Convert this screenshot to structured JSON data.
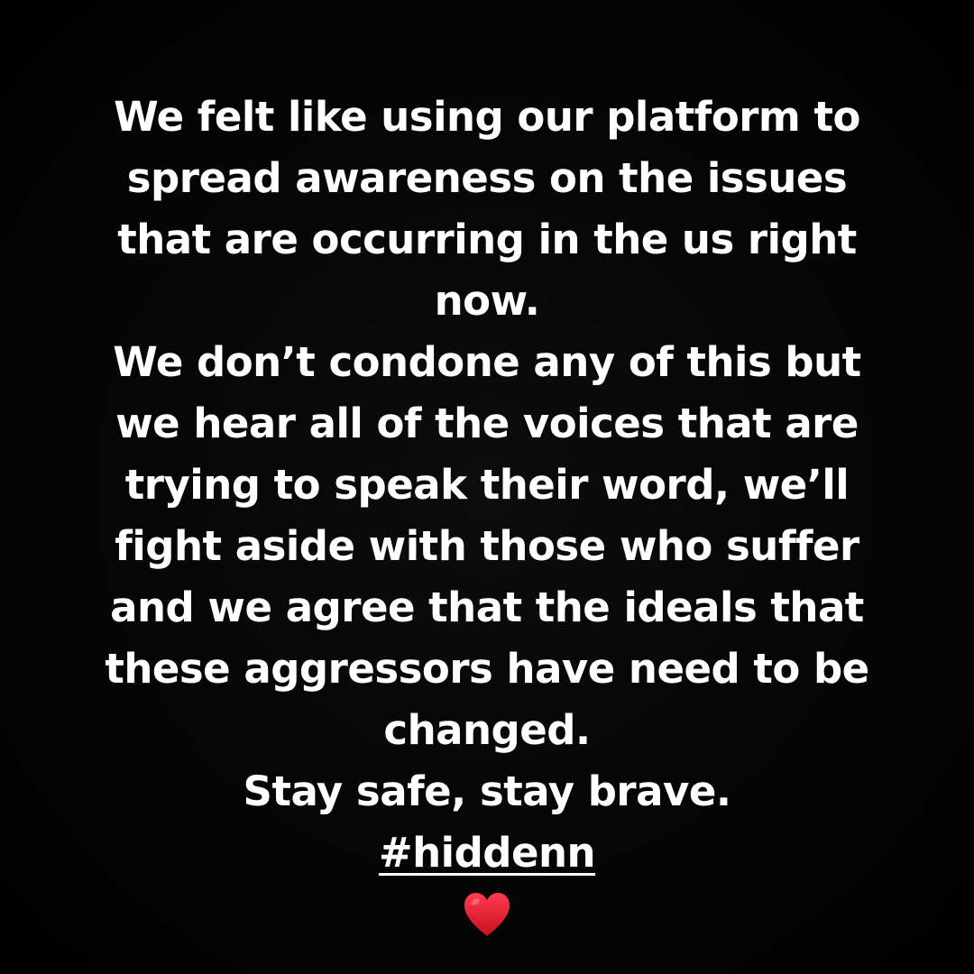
{
  "story": {
    "lines": [
      "We felt like using our platform to",
      "spread awareness on the issues",
      "that are occurring in the us right",
      "now.",
      "We don’t condone any of this but",
      "we hear all of the voices that are",
      "trying to speak their word, we’ll",
      "fight aside with those who suffer",
      "and we agree that the ideals that",
      "these aggressors have need to be",
      "changed.",
      "Stay safe, stay brave."
    ],
    "hashtag": "#hiddenn",
    "emoji_icon": "red-heart-icon",
    "colors": {
      "background": "#000000",
      "text": "#ffffff",
      "heart": "#e0142a"
    }
  }
}
